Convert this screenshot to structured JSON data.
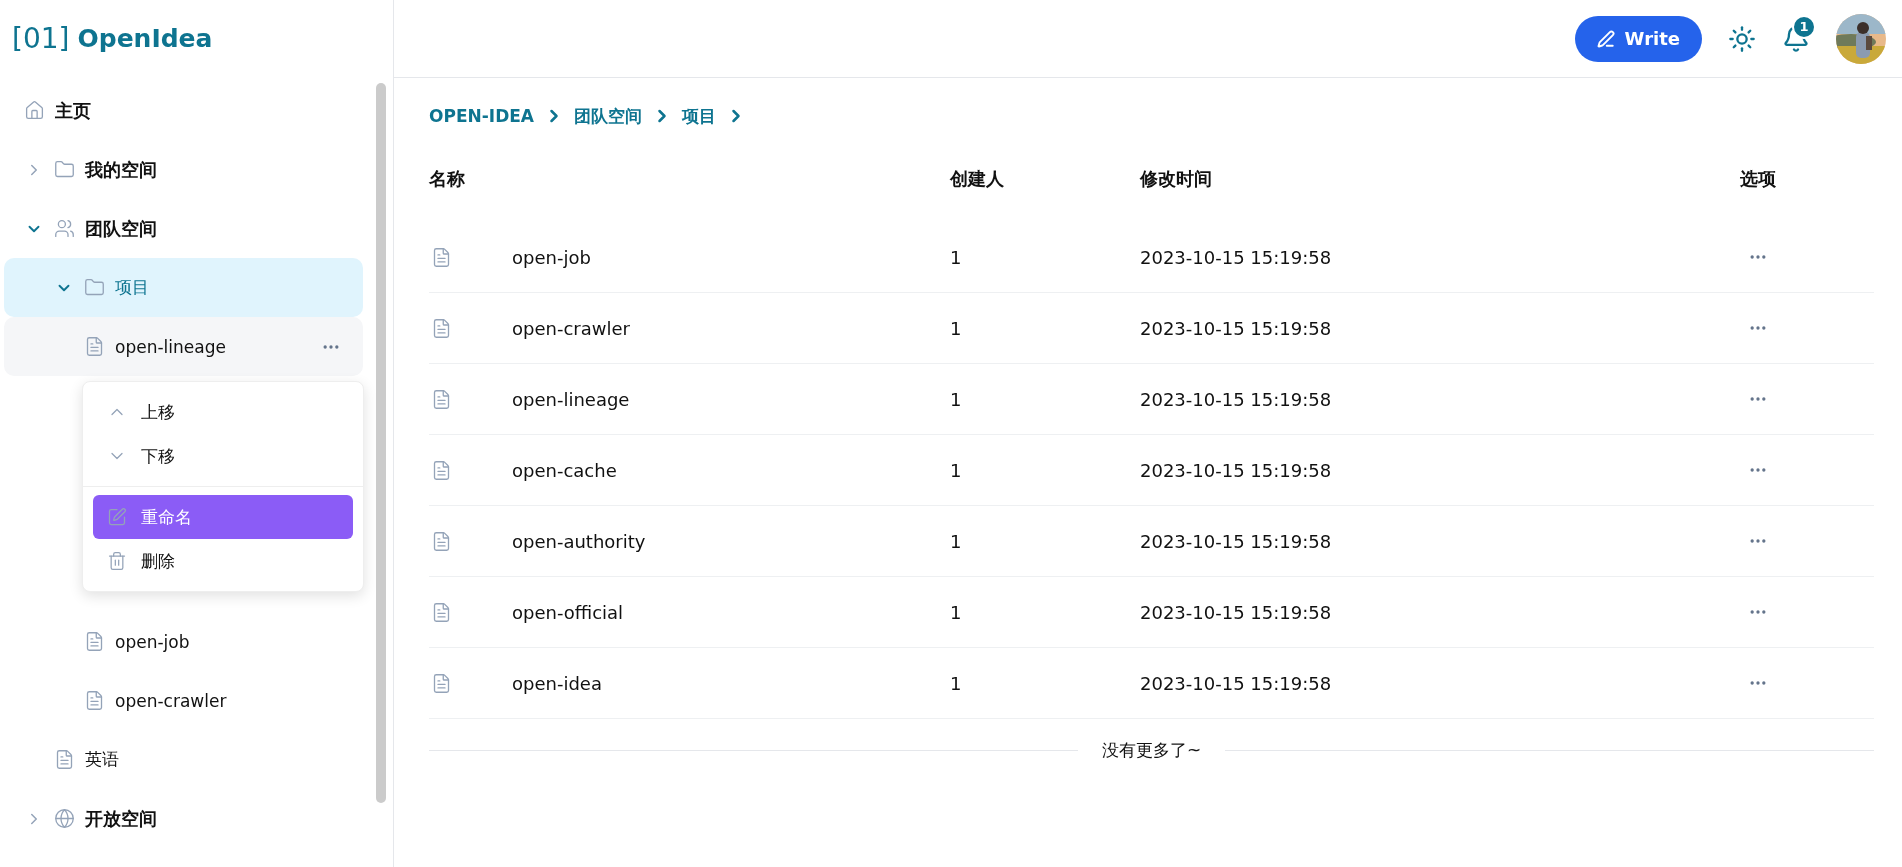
{
  "logo": {
    "prefix": "[01]",
    "name": "OpenIdea"
  },
  "sidebar": {
    "items": [
      {
        "label": "主页",
        "kind": "home",
        "selected": false
      },
      {
        "label": "我的空间",
        "kind": "folder",
        "expanded": false,
        "selected": false
      },
      {
        "label": "团队空间",
        "kind": "team",
        "expanded": true,
        "selected": false,
        "children": [
          {
            "label": "项目",
            "kind": "folder",
            "expanded": true,
            "selected": true,
            "children": [
              {
                "label": "open-lineage",
                "kind": "doc",
                "selected": false,
                "hovered": true,
                "menu": {
                  "items": [
                    {
                      "label": "上移",
                      "kind": "up",
                      "selected": false
                    },
                    {
                      "label": "下移",
                      "kind": "down",
                      "selected": false
                    },
                    {
                      "label": "重命名",
                      "kind": "rename",
                      "selected": true
                    },
                    {
                      "label": "删除",
                      "kind": "delete",
                      "selected": false
                    }
                  ]
                }
              },
              {
                "label": "open-job",
                "kind": "doc",
                "selected": false,
                "hovered": false
              },
              {
                "label": "open-crawler",
                "kind": "doc",
                "selected": false,
                "hovered": false
              }
            ]
          },
          {
            "label": "英语",
            "kind": "doc",
            "selected": false
          }
        ]
      },
      {
        "label": "开放空间",
        "kind": "globe",
        "expanded": false,
        "selected": false
      }
    ]
  },
  "header": {
    "write_button": "Write",
    "notification_count": "1"
  },
  "breadcrumb": [
    "OPEN-IDEA",
    "团队空间",
    "项目"
  ],
  "table": {
    "columns": [
      "名称",
      "创建人",
      "修改时间",
      "选项"
    ],
    "rows": [
      {
        "name": "open-job",
        "creator": "1",
        "modified": "2023-10-15 15:19:58"
      },
      {
        "name": "open-crawler",
        "creator": "1",
        "modified": "2023-10-15 15:19:58"
      },
      {
        "name": "open-lineage",
        "creator": "1",
        "modified": "2023-10-15 15:19:58"
      },
      {
        "name": "open-cache",
        "creator": "1",
        "modified": "2023-10-15 15:19:58"
      },
      {
        "name": "open-authority",
        "creator": "1",
        "modified": "2023-10-15 15:19:58"
      },
      {
        "name": "open-official",
        "creator": "1",
        "modified": "2023-10-15 15:19:58"
      },
      {
        "name": "open-idea",
        "creator": "1",
        "modified": "2023-10-15 15:19:58"
      }
    ]
  },
  "end_message": "没有更多了~"
}
